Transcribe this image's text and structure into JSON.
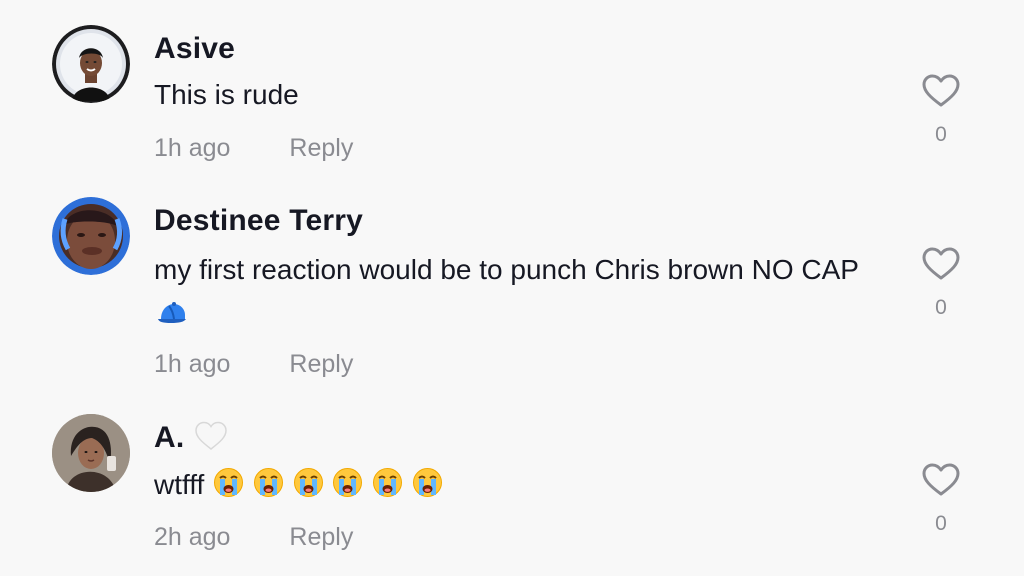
{
  "comments": [
    {
      "username": "Asive",
      "text": "This is rude",
      "time": "1h ago",
      "reply_label": "Reply",
      "like_count": "0"
    },
    {
      "username": "Destinee Terry",
      "text": "my first reaction would be to punch Chris brown NO CAP",
      "emoji": [
        "blue-cap-emoji"
      ],
      "time": "1h ago",
      "reply_label": "Reply",
      "like_count": "0"
    },
    {
      "username": "A.",
      "username_emoji": "white-heart-emoji",
      "text": "wtfff",
      "emoji": [
        "loudly-crying-face-emoji",
        "loudly-crying-face-emoji",
        "loudly-crying-face-emoji",
        "loudly-crying-face-emoji",
        "loudly-crying-face-emoji",
        "loudly-crying-face-emoji"
      ],
      "time": "2h ago",
      "reply_label": "Reply",
      "like_count": "0"
    }
  ],
  "colors": {
    "background": "#f8f8f8",
    "primary_text": "#161823",
    "secondary_text": "#8a8b91",
    "icon_stroke": "#8a8b91"
  }
}
